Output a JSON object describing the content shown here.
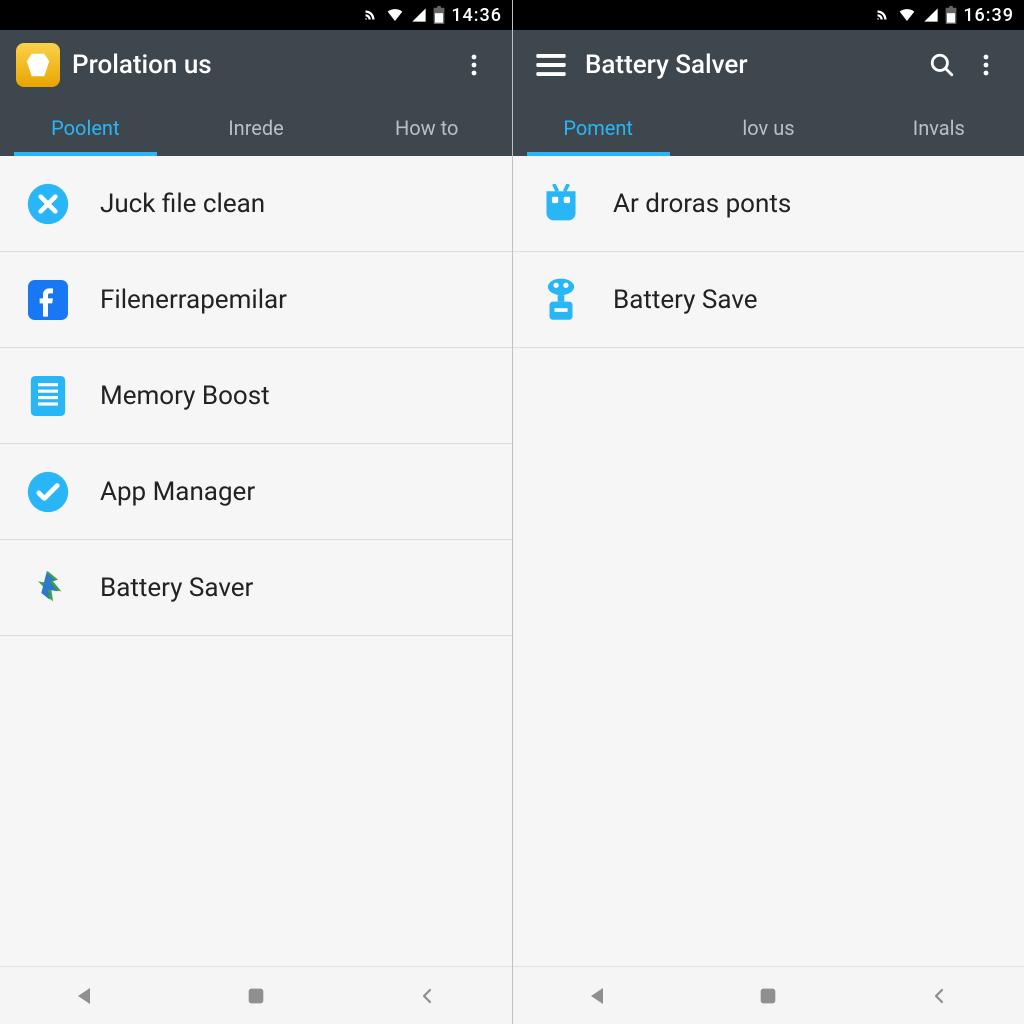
{
  "left": {
    "status_time": "14:36",
    "title": "Prolation us",
    "tabs": [
      "Poolent",
      "Inrede",
      "How to"
    ],
    "active_tab": 0,
    "items": [
      {
        "label": "Juck file clean",
        "icon": "x-circle"
      },
      {
        "label": "Filenerrapemilar",
        "icon": "facebook"
      },
      {
        "label": "Memory Boost",
        "icon": "lines"
      },
      {
        "label": "App Manager",
        "icon": "check-circle"
      },
      {
        "label": "Battery Saver",
        "icon": "swirl"
      }
    ]
  },
  "right": {
    "status_time": "16:39",
    "title": "Battery Salver",
    "tabs": [
      "Poment",
      "lov us",
      "Invals"
    ],
    "active_tab": 0,
    "items": [
      {
        "label": "Ar droras ponts",
        "icon": "robot"
      },
      {
        "label": "Battery Save",
        "icon": "battery-tool"
      }
    ]
  }
}
